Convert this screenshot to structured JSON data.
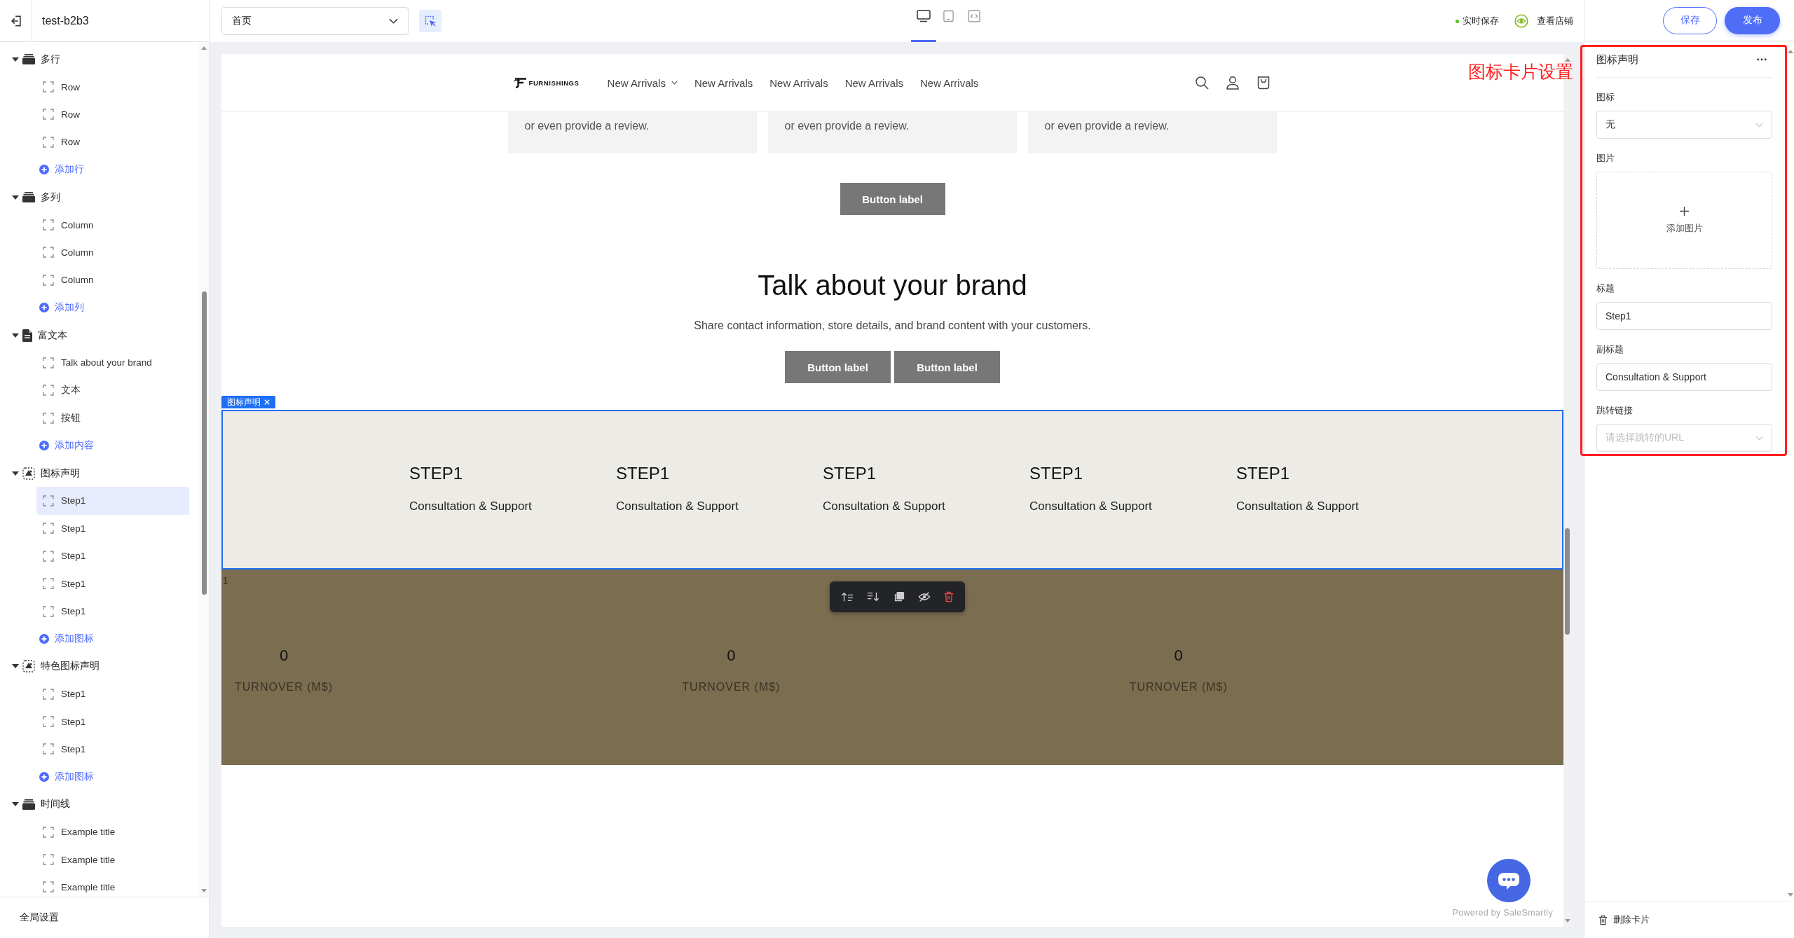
{
  "top_bar": {
    "project_name": "test-b2b3",
    "page_select": {
      "value": "首页"
    },
    "pick_tool": {
      "on": true
    },
    "devices": [
      {
        "kind": "desktop",
        "selected": true
      },
      {
        "kind": "tablet",
        "selected": false
      },
      {
        "kind": "fit",
        "selected": false
      }
    ],
    "save_status": "实时保存",
    "view_store": "查看店铺",
    "buttons": [
      {
        "label": "保存",
        "kind": "outline"
      },
      {
        "label": "发布",
        "kind": "primary"
      }
    ]
  },
  "sidebar": {
    "groups": [
      {
        "label": "多行",
        "kind": "stack",
        "expanded": true,
        "children": [
          {
            "label": "Row",
            "selected": false
          },
          {
            "label": "Row",
            "selected": false
          },
          {
            "label": "Row",
            "selected": false
          }
        ],
        "add_label": "添加行"
      },
      {
        "label": "多列",
        "kind": "stack",
        "expanded": true,
        "children": [
          {
            "label": "Column",
            "selected": false
          },
          {
            "label": "Column",
            "selected": false
          },
          {
            "label": "Column",
            "selected": false
          }
        ],
        "add_label": "添加列"
      },
      {
        "label": "富文本",
        "kind": "document",
        "expanded": true,
        "children": [
          {
            "label": "Talk about your brand",
            "selected": false
          },
          {
            "label": "文本",
            "selected": false
          },
          {
            "label": "按钮",
            "selected": false
          }
        ],
        "add_label": "添加内容"
      },
      {
        "label": "图标声明",
        "kind": "icon",
        "expanded": true,
        "children": [
          {
            "label": "Step1",
            "selected": true
          },
          {
            "label": "Step1",
            "selected": false
          },
          {
            "label": "Step1",
            "selected": false
          },
          {
            "label": "Step1",
            "selected": false
          },
          {
            "label": "Step1",
            "selected": false
          }
        ],
        "add_label": "添加图标"
      },
      {
        "label": "特色图标声明",
        "kind": "icon",
        "expanded": true,
        "children": [
          {
            "label": "Step1",
            "selected": false
          },
          {
            "label": "Step1",
            "selected": false
          },
          {
            "label": "Step1",
            "selected": false
          }
        ],
        "add_label": "添加图标"
      },
      {
        "label": "时间线",
        "kind": "stack",
        "expanded": true,
        "children": [
          {
            "label": "Example title",
            "selected": false
          },
          {
            "label": "Example title",
            "selected": false
          },
          {
            "label": "Example title",
            "selected": false
          }
        ]
      }
    ],
    "footer": "全局设置"
  },
  "preview": {
    "header": {
      "logo": "FURNISHINGS",
      "nav": [
        {
          "label": "New Arrivals",
          "dropdown": true
        },
        {
          "label": "New Arrivals",
          "dropdown": false
        },
        {
          "label": "New Arrivals",
          "dropdown": false
        },
        {
          "label": "New Arrivals",
          "dropdown": false
        },
        {
          "label": "New Arrivals",
          "dropdown": false
        }
      ]
    },
    "review_cards": [
      "or even provide a review.",
      "or even provide a review.",
      "or even provide a review."
    ],
    "cta_button": "Button label",
    "rich_text": {
      "title": "Talk about your brand",
      "body": "Share contact information, store details, and brand content with your customers.",
      "buttons": [
        "Button label",
        "Button label"
      ]
    },
    "icon_cards": {
      "tag": "图标声明",
      "selected": true,
      "items": [
        {
          "title": "STEP1",
          "subtitle": "Consultation & Support"
        },
        {
          "title": "STEP1",
          "subtitle": "Consultation & Support"
        },
        {
          "title": "STEP1",
          "subtitle": "Consultation & Support"
        },
        {
          "title": "STEP1",
          "subtitle": "Consultation & Support"
        },
        {
          "title": "STEP1",
          "subtitle": "Consultation & Support"
        }
      ]
    },
    "counters": {
      "corner_text": "1",
      "items": [
        {
          "value": "0",
          "label": "TURNOVER (M$)"
        },
        {
          "value": "0",
          "label": "TURNOVER (M$)"
        },
        {
          "value": "0",
          "label": "TURNOVER (M$)"
        }
      ]
    },
    "chat_widget": {
      "powered_by": "Powered by SaleSmartly"
    }
  },
  "settings_panel": {
    "title": "图标声明",
    "fields": [
      {
        "kind": "select",
        "label": "图标",
        "value": "无"
      },
      {
        "kind": "upload",
        "label": "图片",
        "action": "添加图片"
      },
      {
        "kind": "text",
        "label": "标题",
        "value": "Step1"
      },
      {
        "kind": "text",
        "label": "副标题",
        "value": "Consultation & Support"
      },
      {
        "kind": "select",
        "label": "跳转链接",
        "placeholder": "请选择跳转的URL"
      }
    ],
    "delete_action": "删除卡片"
  },
  "annotation": {
    "text": "图标卡片设置"
  }
}
